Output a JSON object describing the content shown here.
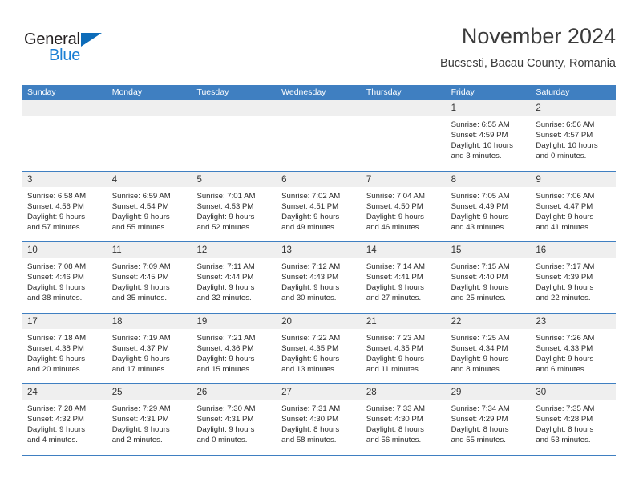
{
  "brand": {
    "name_part1": "General",
    "name_part2": "Blue",
    "triangle_color": "#0d6cb9",
    "blue_color": "#1b7fd4"
  },
  "header": {
    "month_title": "November 2024",
    "location": "Bucsesti, Bacau County, Romania"
  },
  "theme": {
    "header_blue": "#3f7fc1",
    "date_band_grey": "#efefef",
    "text_color": "#2b2b2b"
  },
  "weekdays": [
    "Sunday",
    "Monday",
    "Tuesday",
    "Wednesday",
    "Thursday",
    "Friday",
    "Saturday"
  ],
  "weeks": [
    [
      {
        "day": "",
        "lines": []
      },
      {
        "day": "",
        "lines": []
      },
      {
        "day": "",
        "lines": []
      },
      {
        "day": "",
        "lines": []
      },
      {
        "day": "",
        "lines": []
      },
      {
        "day": "1",
        "lines": [
          "Sunrise: 6:55 AM",
          "Sunset: 4:59 PM",
          "Daylight: 10 hours",
          "and 3 minutes."
        ]
      },
      {
        "day": "2",
        "lines": [
          "Sunrise: 6:56 AM",
          "Sunset: 4:57 PM",
          "Daylight: 10 hours",
          "and 0 minutes."
        ]
      }
    ],
    [
      {
        "day": "3",
        "lines": [
          "Sunrise: 6:58 AM",
          "Sunset: 4:56 PM",
          "Daylight: 9 hours",
          "and 57 minutes."
        ]
      },
      {
        "day": "4",
        "lines": [
          "Sunrise: 6:59 AM",
          "Sunset: 4:54 PM",
          "Daylight: 9 hours",
          "and 55 minutes."
        ]
      },
      {
        "day": "5",
        "lines": [
          "Sunrise: 7:01 AM",
          "Sunset: 4:53 PM",
          "Daylight: 9 hours",
          "and 52 minutes."
        ]
      },
      {
        "day": "6",
        "lines": [
          "Sunrise: 7:02 AM",
          "Sunset: 4:51 PM",
          "Daylight: 9 hours",
          "and 49 minutes."
        ]
      },
      {
        "day": "7",
        "lines": [
          "Sunrise: 7:04 AM",
          "Sunset: 4:50 PM",
          "Daylight: 9 hours",
          "and 46 minutes."
        ]
      },
      {
        "day": "8",
        "lines": [
          "Sunrise: 7:05 AM",
          "Sunset: 4:49 PM",
          "Daylight: 9 hours",
          "and 43 minutes."
        ]
      },
      {
        "day": "9",
        "lines": [
          "Sunrise: 7:06 AM",
          "Sunset: 4:47 PM",
          "Daylight: 9 hours",
          "and 41 minutes."
        ]
      }
    ],
    [
      {
        "day": "10",
        "lines": [
          "Sunrise: 7:08 AM",
          "Sunset: 4:46 PM",
          "Daylight: 9 hours",
          "and 38 minutes."
        ]
      },
      {
        "day": "11",
        "lines": [
          "Sunrise: 7:09 AM",
          "Sunset: 4:45 PM",
          "Daylight: 9 hours",
          "and 35 minutes."
        ]
      },
      {
        "day": "12",
        "lines": [
          "Sunrise: 7:11 AM",
          "Sunset: 4:44 PM",
          "Daylight: 9 hours",
          "and 32 minutes."
        ]
      },
      {
        "day": "13",
        "lines": [
          "Sunrise: 7:12 AM",
          "Sunset: 4:43 PM",
          "Daylight: 9 hours",
          "and 30 minutes."
        ]
      },
      {
        "day": "14",
        "lines": [
          "Sunrise: 7:14 AM",
          "Sunset: 4:41 PM",
          "Daylight: 9 hours",
          "and 27 minutes."
        ]
      },
      {
        "day": "15",
        "lines": [
          "Sunrise: 7:15 AM",
          "Sunset: 4:40 PM",
          "Daylight: 9 hours",
          "and 25 minutes."
        ]
      },
      {
        "day": "16",
        "lines": [
          "Sunrise: 7:17 AM",
          "Sunset: 4:39 PM",
          "Daylight: 9 hours",
          "and 22 minutes."
        ]
      }
    ],
    [
      {
        "day": "17",
        "lines": [
          "Sunrise: 7:18 AM",
          "Sunset: 4:38 PM",
          "Daylight: 9 hours",
          "and 20 minutes."
        ]
      },
      {
        "day": "18",
        "lines": [
          "Sunrise: 7:19 AM",
          "Sunset: 4:37 PM",
          "Daylight: 9 hours",
          "and 17 minutes."
        ]
      },
      {
        "day": "19",
        "lines": [
          "Sunrise: 7:21 AM",
          "Sunset: 4:36 PM",
          "Daylight: 9 hours",
          "and 15 minutes."
        ]
      },
      {
        "day": "20",
        "lines": [
          "Sunrise: 7:22 AM",
          "Sunset: 4:35 PM",
          "Daylight: 9 hours",
          "and 13 minutes."
        ]
      },
      {
        "day": "21",
        "lines": [
          "Sunrise: 7:23 AM",
          "Sunset: 4:35 PM",
          "Daylight: 9 hours",
          "and 11 minutes."
        ]
      },
      {
        "day": "22",
        "lines": [
          "Sunrise: 7:25 AM",
          "Sunset: 4:34 PM",
          "Daylight: 9 hours",
          "and 8 minutes."
        ]
      },
      {
        "day": "23",
        "lines": [
          "Sunrise: 7:26 AM",
          "Sunset: 4:33 PM",
          "Daylight: 9 hours",
          "and 6 minutes."
        ]
      }
    ],
    [
      {
        "day": "24",
        "lines": [
          "Sunrise: 7:28 AM",
          "Sunset: 4:32 PM",
          "Daylight: 9 hours",
          "and 4 minutes."
        ]
      },
      {
        "day": "25",
        "lines": [
          "Sunrise: 7:29 AM",
          "Sunset: 4:31 PM",
          "Daylight: 9 hours",
          "and 2 minutes."
        ]
      },
      {
        "day": "26",
        "lines": [
          "Sunrise: 7:30 AM",
          "Sunset: 4:31 PM",
          "Daylight: 9 hours",
          "and 0 minutes."
        ]
      },
      {
        "day": "27",
        "lines": [
          "Sunrise: 7:31 AM",
          "Sunset: 4:30 PM",
          "Daylight: 8 hours",
          "and 58 minutes."
        ]
      },
      {
        "day": "28",
        "lines": [
          "Sunrise: 7:33 AM",
          "Sunset: 4:30 PM",
          "Daylight: 8 hours",
          "and 56 minutes."
        ]
      },
      {
        "day": "29",
        "lines": [
          "Sunrise: 7:34 AM",
          "Sunset: 4:29 PM",
          "Daylight: 8 hours",
          "and 55 minutes."
        ]
      },
      {
        "day": "30",
        "lines": [
          "Sunrise: 7:35 AM",
          "Sunset: 4:28 PM",
          "Daylight: 8 hours",
          "and 53 minutes."
        ]
      }
    ]
  ]
}
